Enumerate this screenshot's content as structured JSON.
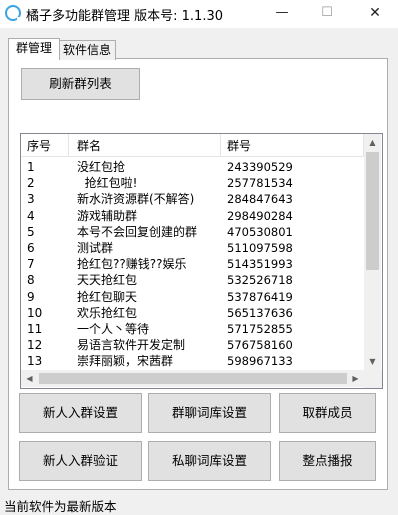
{
  "window": {
    "title": "橘子多功能群管理 版本号: 1.1.30",
    "min_glyph": "—",
    "max_glyph": "☐",
    "close_glyph": "✕"
  },
  "tabs": [
    {
      "label": "群管理",
      "active": true
    },
    {
      "label": "软件信息",
      "active": false
    }
  ],
  "toolbar": {
    "refresh_label": "刷新群列表"
  },
  "table": {
    "columns": [
      "序号",
      "群名",
      "群号"
    ],
    "rows": [
      {
        "no": "1",
        "name": "没红包抢",
        "id": "243390529"
      },
      {
        "no": "2",
        "name": "  抢红包啦!",
        "id": "257781534"
      },
      {
        "no": "3",
        "name": "新水浒资源群(不解答)",
        "id": "284847643"
      },
      {
        "no": "4",
        "name": "游戏辅助群",
        "id": "298490284"
      },
      {
        "no": "5",
        "name": "本号不会回复创建的群",
        "id": "470530801"
      },
      {
        "no": "6",
        "name": "测试群",
        "id": "511097598"
      },
      {
        "no": "7",
        "name": "抢红包??赚钱??娱乐",
        "id": "514351993"
      },
      {
        "no": "8",
        "name": "天天抢红包",
        "id": "532526718"
      },
      {
        "no": "9",
        "name": "抢红包聊天",
        "id": "537876419"
      },
      {
        "no": "10",
        "name": "欢乐抢红包",
        "id": "565137636"
      },
      {
        "no": "11",
        "name": "一个人丶等待",
        "id": "571752855"
      },
      {
        "no": "12",
        "name": "易语言软件开发定制",
        "id": "576758160"
      },
      {
        "no": "13",
        "name": "崇拜丽颖，宋茜群",
        "id": "598967133"
      }
    ]
  },
  "buttons": {
    "welcome_settings": "新人入群设置",
    "chat_lexicon_settings": "群聊词库设置",
    "get_members": "取群成员",
    "verify_new": "新人入群验证",
    "private_lexicon_settings": "私聊词库设置",
    "hourly_broadcast": "整点播报"
  },
  "status_text": "当前软件为最新版本",
  "colors": {
    "icon_accent": "#3aa3e3",
    "button_face": "#e1e1e1",
    "window_bg": "#f0f0f0"
  }
}
